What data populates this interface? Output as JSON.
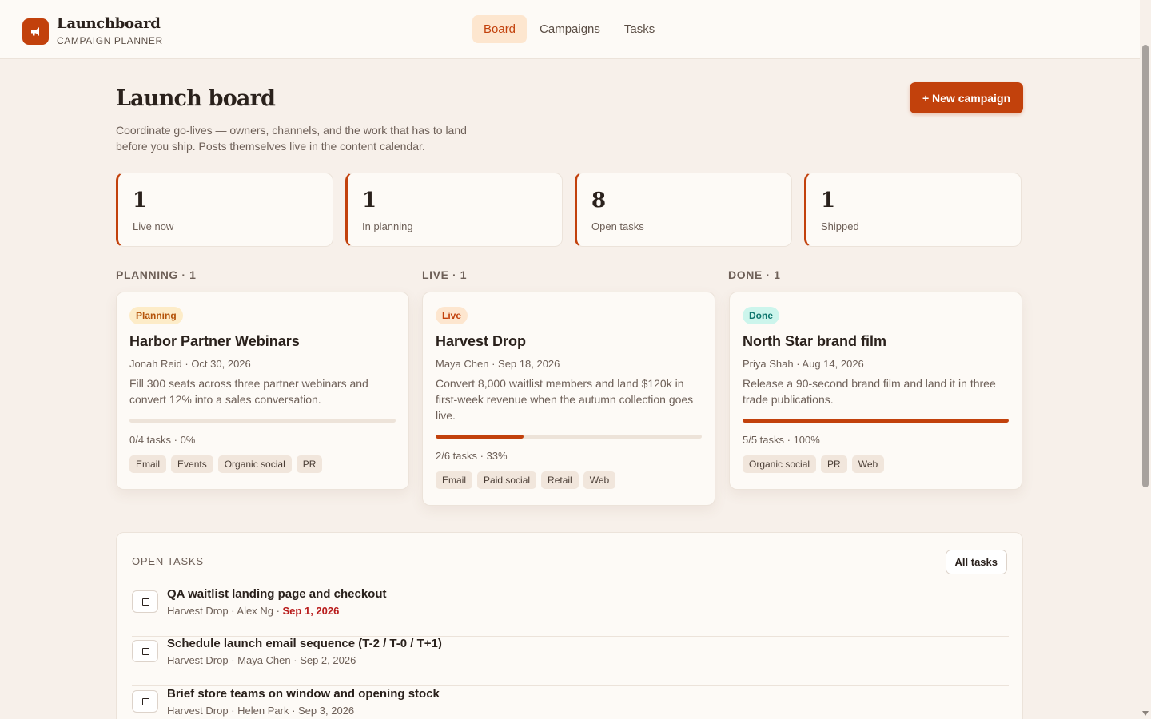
{
  "app": {
    "name": "Launchboard",
    "subtitle": "CAMPAIGN PLANNER"
  },
  "nav": {
    "tabs": [
      {
        "label": "Board",
        "active": true
      },
      {
        "label": "Campaigns",
        "active": false
      },
      {
        "label": "Tasks",
        "active": false
      }
    ]
  },
  "page": {
    "title": "Launch board",
    "description": "Coordinate go-lives — owners, channels, and the work that has to land before you ship. Posts themselves live in the content calendar.",
    "new_button": "+ New campaign"
  },
  "stats": [
    {
      "value": "1",
      "label": "Live now"
    },
    {
      "value": "1",
      "label": "In planning"
    },
    {
      "value": "8",
      "label": "Open tasks"
    },
    {
      "value": "1",
      "label": "Shipped"
    }
  ],
  "columns": [
    {
      "heading": "PLANNING · 1",
      "card": {
        "badge": "Planning",
        "title": "Harbor Partner Webinars",
        "meta": "Jonah Reid · Oct 30, 2026",
        "description": "Fill 300 seats across three partner webinars and convert 12% into a sales conversation.",
        "progress": 0,
        "progress_text": "0/4 tasks · 0%",
        "tags": [
          "Email",
          "Events",
          "Organic social",
          "PR"
        ]
      }
    },
    {
      "heading": "LIVE · 1",
      "card": {
        "badge": "Live",
        "title": "Harvest Drop",
        "meta": "Maya Chen · Sep 18, 2026",
        "description": "Convert 8,000 waitlist members and land $120k in first-week revenue when the autumn collection goes live.",
        "progress": 33,
        "progress_text": "2/6 tasks · 33%",
        "tags": [
          "Email",
          "Paid social",
          "Retail",
          "Web"
        ]
      }
    },
    {
      "heading": "DONE · 1",
      "card": {
        "badge": "Done",
        "title": "North Star brand film",
        "meta": "Priya Shah · Aug 14, 2026",
        "description": "Release a 90-second brand film and land it in three trade publications.",
        "progress": 100,
        "progress_text": "5/5 tasks · 100%",
        "tags": [
          "Organic social",
          "PR",
          "Web"
        ]
      }
    }
  ],
  "badge_colors": {
    "Planning": {
      "bg": "#fdecc8",
      "fg": "#b45309"
    },
    "Live": {
      "bg": "#fde6cf",
      "fg": "#c2410c"
    },
    "Done": {
      "bg": "#ccf5ec",
      "fg": "#0f766e"
    }
  },
  "tasks": {
    "heading": "OPEN TASKS",
    "all_button": "All tasks",
    "items": [
      {
        "title": "QA waitlist landing page and checkout",
        "campaign": "Harvest Drop",
        "owner": "Alex Ng",
        "due": "Sep 1, 2026",
        "overdue": true
      },
      {
        "title": "Schedule launch email sequence (T-2 / T-0 / T+1)",
        "campaign": "Harvest Drop",
        "owner": "Maya Chen",
        "due": "Sep 2, 2026",
        "overdue": false
      },
      {
        "title": "Brief store teams on window and opening stock",
        "campaign": "Harvest Drop",
        "owner": "Helen Park",
        "due": "Sep 3, 2026",
        "overdue": false
      }
    ]
  },
  "colors": {
    "accent": "#c2410c",
    "background": "#f7f0ea",
    "surface": "#fdfaf6",
    "overdue": "#b91c1c"
  },
  "icons": {
    "brand": "megaphone-icon",
    "task_check": "checkbox-icon"
  }
}
